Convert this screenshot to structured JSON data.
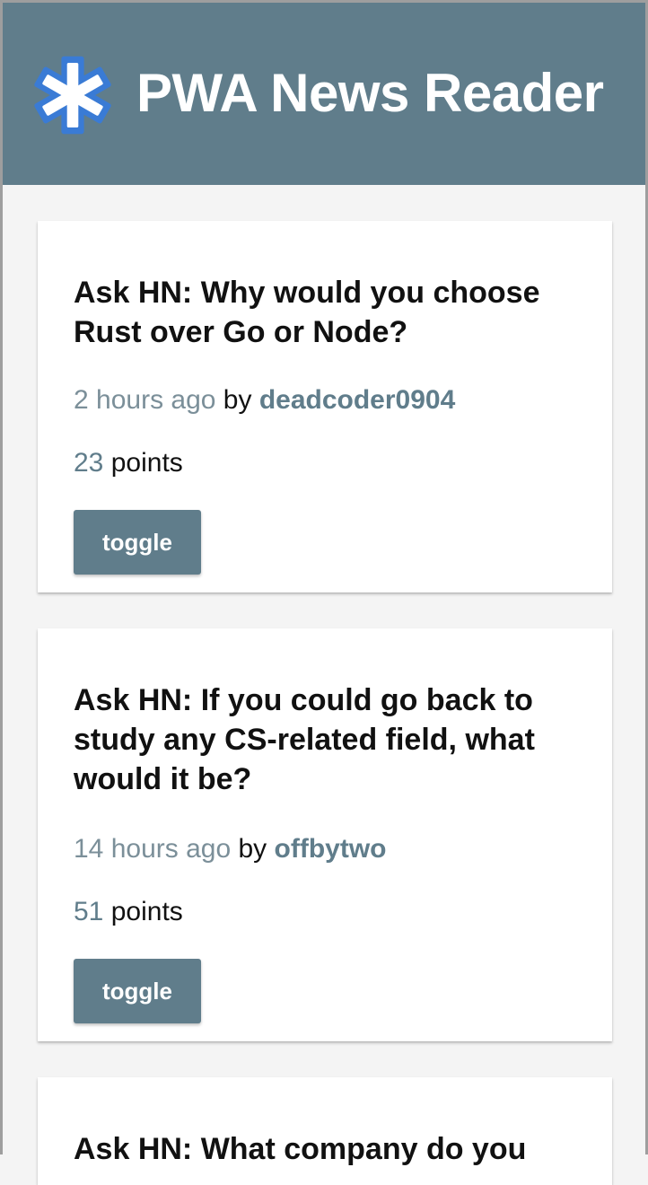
{
  "header": {
    "title": "PWA News Reader",
    "logo_icon": "asterisk-icon",
    "background": "#607d8b",
    "logo_color": "#3a7bd5"
  },
  "stories": [
    {
      "title": "Ask HN: Why would you choose Rust over Go or Node?",
      "time": "2 hours ago",
      "by": "by",
      "author": "deadcoder0904",
      "points": "23",
      "points_label": "points",
      "toggle_label": "toggle"
    },
    {
      "title": "Ask HN: If you could go back to study any CS-related field, what would it be?",
      "time": "14 hours ago",
      "by": "by",
      "author": "offbytwo",
      "points": "51",
      "points_label": "points",
      "toggle_label": "toggle"
    },
    {
      "title": "Ask HN: What company do you"
    }
  ]
}
